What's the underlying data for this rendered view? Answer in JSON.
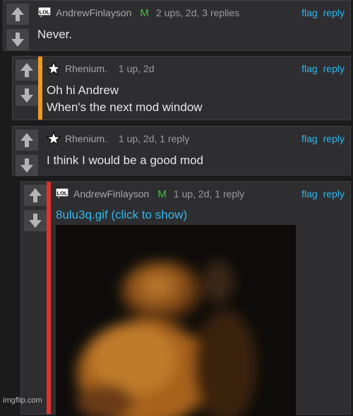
{
  "colors": {
    "accent": "#2fb7ee",
    "mod": "#3fbf3f",
    "orange": "#f09a1f",
    "red": "#e0332e"
  },
  "comments": [
    {
      "user": "AndrewFinlayson",
      "badge": "LOL",
      "mod": "M",
      "meta": "2 ups, 2d, 3 replies",
      "text": [
        "Never."
      ]
    },
    {
      "user": "Rhenium.",
      "meta": "1 up, 2d",
      "text": [
        "Oh hi Andrew",
        "When's the next mod window"
      ]
    },
    {
      "user": "Rhenium.",
      "meta": "1 up, 2d, 1 reply",
      "text": [
        "I think I would be a good mod"
      ]
    },
    {
      "user": "AndrewFinlayson",
      "badge": "LOL",
      "mod": "M",
      "meta": "1 up, 2d, 1 reply",
      "link": "8ulu3q.gif (click to show)"
    }
  ],
  "actions": {
    "flag": "flag",
    "reply": "reply"
  },
  "watermark": "imgflip.com"
}
